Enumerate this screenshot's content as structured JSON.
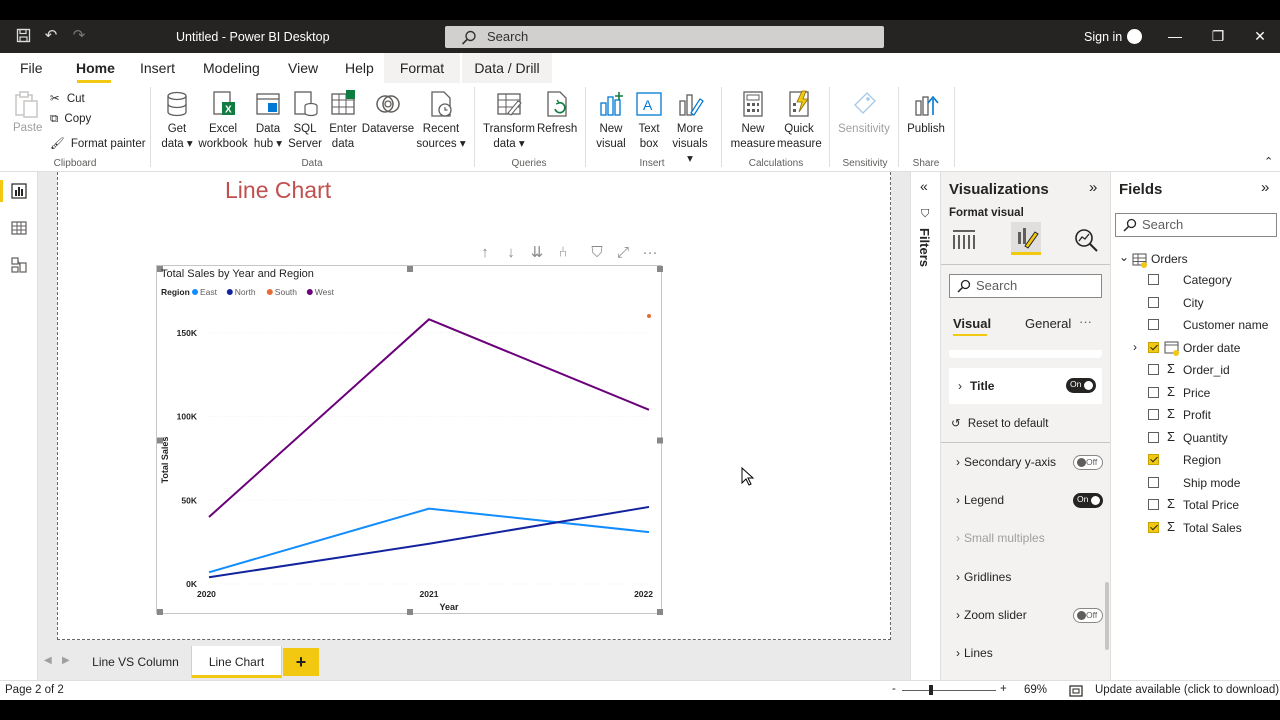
{
  "window": {
    "title": "Untitled - Power BI Desktop",
    "search_placeholder": "Search",
    "sign_in": "Sign in"
  },
  "menu": {
    "items": [
      "File",
      "Home",
      "Insert",
      "Modeling",
      "View",
      "Help",
      "Format",
      "Data / Drill"
    ],
    "active": "Home"
  },
  "ribbon": {
    "clipboard": {
      "paste": "Paste",
      "cut": "Cut",
      "copy": "Copy",
      "format_painter": "Format painter",
      "label": "Clipboard"
    },
    "data": {
      "buttons": [
        {
          "line1": "Get",
          "line2": "data ▾"
        },
        {
          "line1": "Excel",
          "line2": "workbook"
        },
        {
          "line1": "Data",
          "line2": "hub ▾"
        },
        {
          "line1": "SQL",
          "line2": "Server"
        },
        {
          "line1": "Enter",
          "line2": "data"
        },
        {
          "line1": "Dataverse",
          "line2": ""
        },
        {
          "line1": "Recent",
          "line2": "sources ▾"
        }
      ],
      "label": "Data"
    },
    "queries": {
      "buttons": [
        {
          "line1": "Transform",
          "line2": "data ▾"
        },
        {
          "line1": "Refresh",
          "line2": ""
        }
      ],
      "label": "Queries"
    },
    "insert": {
      "buttons": [
        {
          "line1": "New",
          "line2": "visual"
        },
        {
          "line1": "Text",
          "line2": "box"
        },
        {
          "line1": "More",
          "line2": "visuals ▾"
        }
      ],
      "label": "Insert"
    },
    "calculations": {
      "buttons": [
        {
          "line1": "New",
          "line2": "measure"
        },
        {
          "line1": "Quick",
          "line2": "measure"
        }
      ],
      "label": "Calculations"
    },
    "sensitivity": {
      "button": "Sensitivity",
      "label": "Sensitivity"
    },
    "share": {
      "button": "Publish",
      "label": "Share"
    }
  },
  "canvas": {
    "page_title": "Line Chart"
  },
  "chart_data": {
    "type": "line",
    "title": "Total Sales by Year and Region",
    "legend_title": "Region",
    "legend_position": "top-left",
    "xlabel": "Year",
    "ylabel": "Total Sales",
    "categories": [
      "2020",
      "2021",
      "2022"
    ],
    "y_ticks": [
      "0K",
      "50K",
      "100K",
      "150K"
    ],
    "ylim": [
      0,
      160000
    ],
    "grid": true,
    "series": [
      {
        "name": "East",
        "color": "#118dff",
        "values": [
          7000,
          45000,
          31000
        ]
      },
      {
        "name": "North",
        "color": "#12239e",
        "values": [
          4000,
          24000,
          46000
        ]
      },
      {
        "name": "South",
        "color": "#e66c37",
        "values": [
          null,
          null,
          160000
        ]
      },
      {
        "name": "West",
        "color": "#6b007b",
        "values": [
          40000,
          158000,
          104000
        ]
      }
    ]
  },
  "filters": {
    "label": "Filters"
  },
  "visualizations": {
    "title": "Visualizations",
    "subtitle": "Format visual",
    "search_placeholder": "Search",
    "tabs": [
      "Visual",
      "General"
    ],
    "more": "···",
    "title_card": {
      "label": "Title",
      "toggle": "On"
    },
    "reset": "Reset to default",
    "sections": [
      {
        "label": "Secondary y-axis",
        "toggle": "Off",
        "disabled": false
      },
      {
        "label": "Legend",
        "toggle": "On",
        "disabled": false
      },
      {
        "label": "Small multiples",
        "toggle": "",
        "disabled": true
      },
      {
        "label": "Gridlines",
        "toggle": "",
        "disabled": false
      },
      {
        "label": "Zoom slider",
        "toggle": "Off",
        "disabled": false
      },
      {
        "label": "Lines",
        "toggle": "",
        "disabled": false
      }
    ]
  },
  "fields": {
    "title": "Fields",
    "search_placeholder": "Search",
    "table_name": "Orders",
    "items": [
      {
        "name": "Category",
        "checked": false,
        "sigma": false
      },
      {
        "name": "City",
        "checked": false,
        "sigma": false
      },
      {
        "name": "Customer name",
        "checked": false,
        "sigma": false
      },
      {
        "name": "Order date",
        "checked": true,
        "sigma": false,
        "date": true
      },
      {
        "name": "Order_id",
        "checked": false,
        "sigma": true
      },
      {
        "name": "Price",
        "checked": false,
        "sigma": true
      },
      {
        "name": "Profit",
        "checked": false,
        "sigma": true
      },
      {
        "name": "Quantity",
        "checked": false,
        "sigma": true
      },
      {
        "name": "Region",
        "checked": true,
        "sigma": false
      },
      {
        "name": "Ship mode",
        "checked": false,
        "sigma": false
      },
      {
        "name": "Total Price",
        "checked": false,
        "sigma": true
      },
      {
        "name": "Total Sales",
        "checked": true,
        "sigma": true
      }
    ]
  },
  "pages": {
    "tabs": [
      "Line VS Column",
      "Line Chart"
    ],
    "active": "Line Chart",
    "add": "+"
  },
  "status": {
    "page": "Page 2 of 2",
    "zoom_minus": "-",
    "zoom_plus": "+",
    "zoom": "69%",
    "update": "Update available (click to download)"
  },
  "colors": {
    "accent": "#f2c811",
    "title_color": "#c0504d"
  }
}
